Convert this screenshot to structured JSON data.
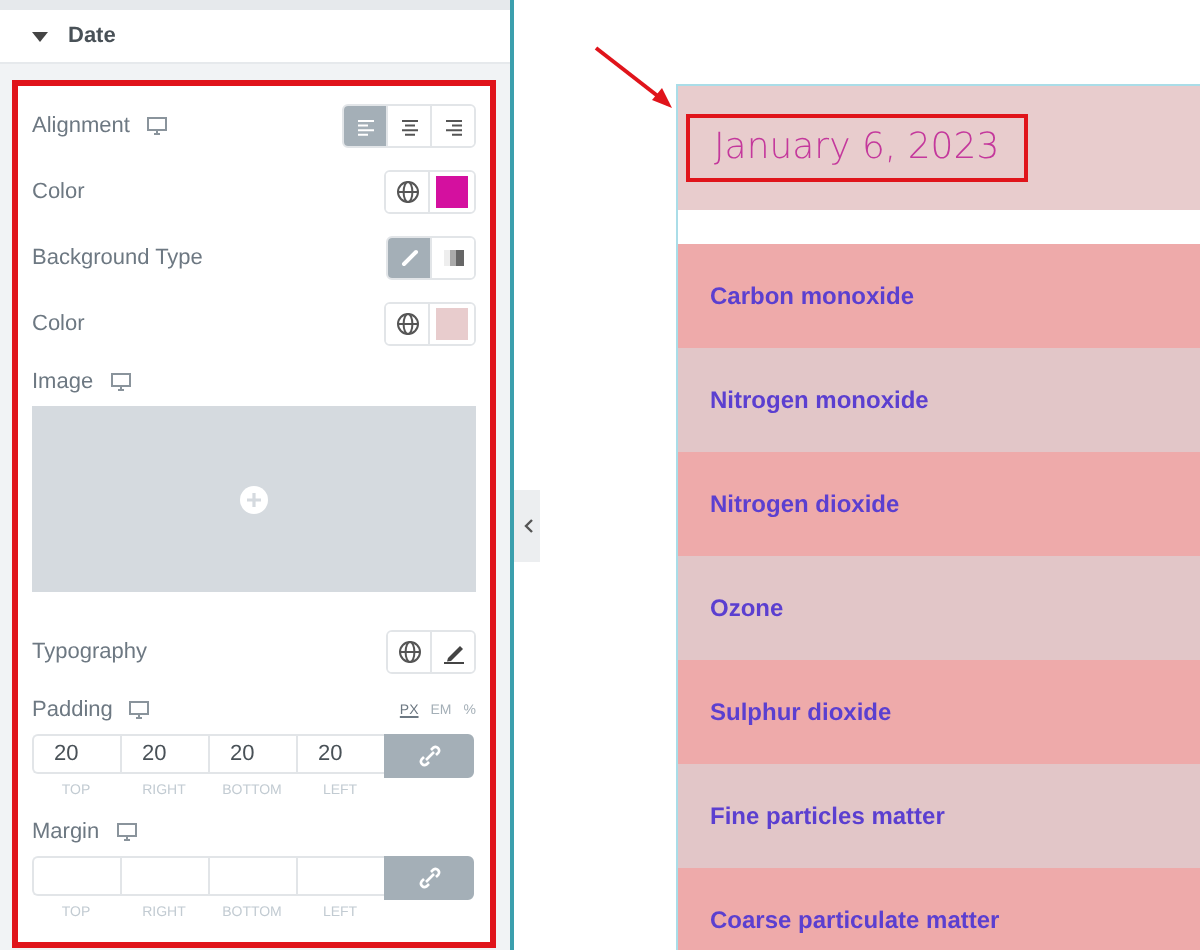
{
  "section": {
    "title": "Date",
    "expanded": true
  },
  "controls": [
    {
      "kind": "choice",
      "label": "Alignment",
      "responsive": true,
      "options": [
        {
          "kind": "left",
          "selected": true
        },
        {
          "kind": "center",
          "selected": false
        },
        {
          "kind": "right",
          "selected": false
        }
      ]
    },
    {
      "kind": "color",
      "label": "Color",
      "color": "#d4109f"
    },
    {
      "kind": "choice",
      "label": "Background Type",
      "responsive": false,
      "options": [
        {
          "kind": "classic",
          "selected": true
        },
        {
          "kind": "gradient",
          "selected": false
        }
      ]
    },
    {
      "kind": "color",
      "label": "Color",
      "color": "#e8cccd"
    },
    {
      "kind": "image",
      "label": "Image",
      "responsive": true
    },
    {
      "kind": "typography",
      "label": "Typography"
    },
    {
      "kind": "dimensions",
      "label": "Padding",
      "responsive": true,
      "units": [
        {
          "label": "PX",
          "selected": true
        },
        {
          "label": "EM",
          "selected": false
        },
        {
          "label": "%",
          "selected": false
        }
      ],
      "values": [
        "20",
        "20",
        "20",
        "20"
      ],
      "sides": [
        "TOP",
        "RIGHT",
        "BOTTOM",
        "LEFT"
      ],
      "linked": true
    },
    {
      "kind": "dimensions",
      "label": "Margin",
      "responsive": true,
      "sides": [
        "TOP",
        "RIGHT",
        "BOTTOM",
        "LEFT"
      ],
      "linked": true
    }
  ],
  "preview": {
    "date": "January 6, 2023",
    "items": [
      {
        "label": "Carbon monoxide"
      },
      {
        "label": "Nitrogen monoxide"
      },
      {
        "label": "Nitrogen dioxide"
      },
      {
        "label": "Ozone"
      },
      {
        "label": "Sulphur dioxide"
      },
      {
        "label": "Fine particles matter"
      },
      {
        "label": "Coarse particulate matter"
      }
    ]
  }
}
